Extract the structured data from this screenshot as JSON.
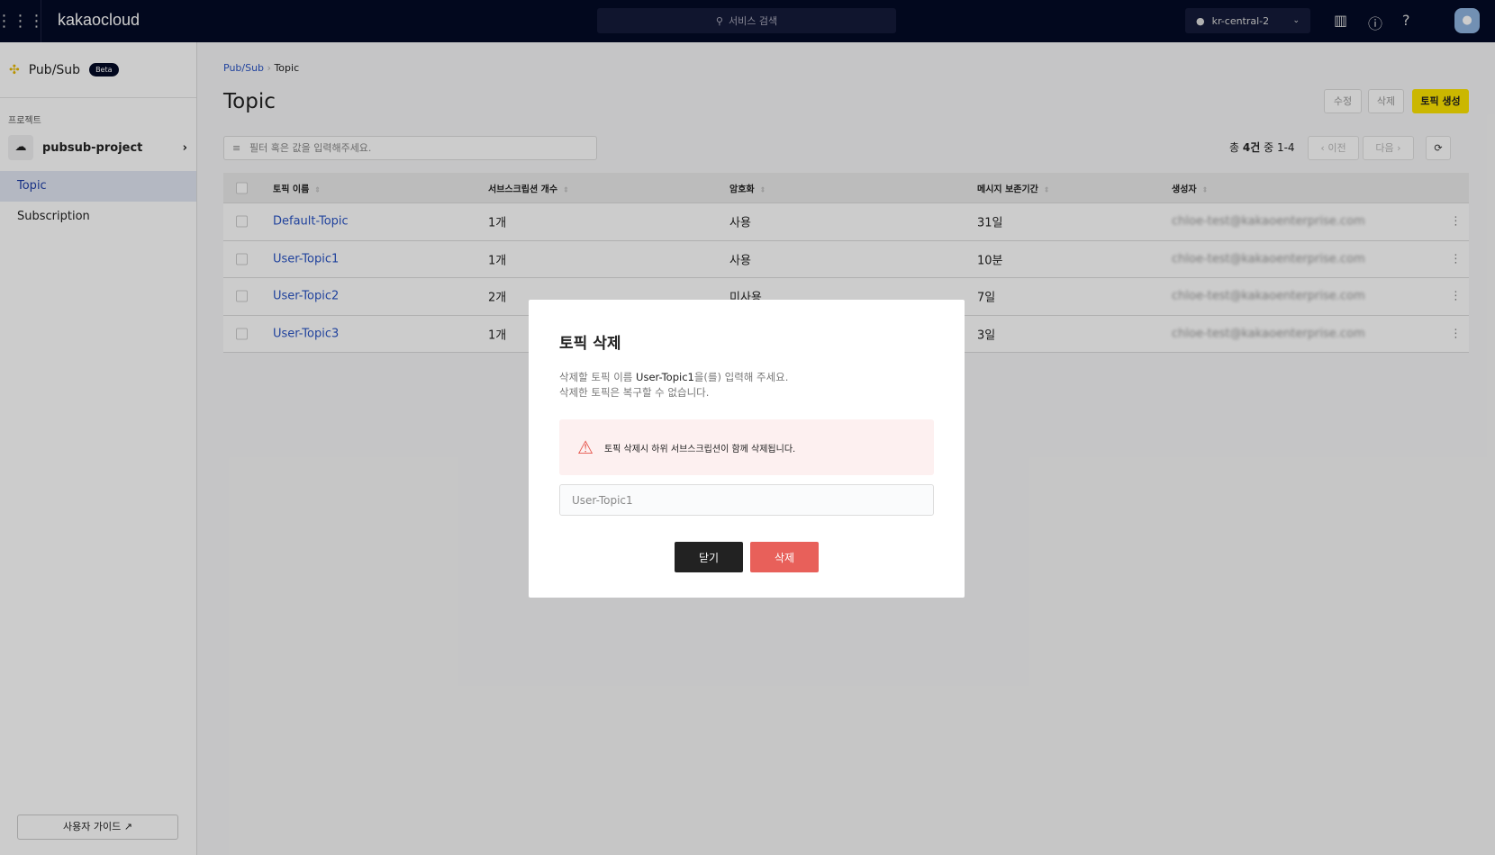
{
  "topbar": {
    "logo": "kakaocloud",
    "search_placeholder": "서비스 검색",
    "region": "kr-central-2"
  },
  "sidebar": {
    "service": "Pub/Sub",
    "badge": "Beta",
    "section": "프로젝트",
    "project": "pubsub-project",
    "items": [
      {
        "label": "Topic",
        "active": true
      },
      {
        "label": "Subscription",
        "active": false
      }
    ],
    "guide": "사용자 가이드"
  },
  "breadcrumb": {
    "parent": "Pub/Sub",
    "current": "Topic"
  },
  "page": {
    "title": "Topic",
    "edit": "수정",
    "delete": "삭제",
    "create": "토픽 생성",
    "filter_placeholder": "필터 혹은 값을 입력해주세요."
  },
  "pagination": {
    "prefix": "총",
    "total": "4건",
    "mid": "중",
    "range": "1-4",
    "prev": "이전",
    "next": "다음"
  },
  "table": {
    "headers": [
      "토픽 이름",
      "서브스크립션 개수",
      "암호화",
      "메시지 보존기간",
      "생성자"
    ],
    "rows": [
      [
        "Default-Topic",
        "1개",
        "사용",
        "31일",
        "chloe-test@kakaoenterprise.com"
      ],
      [
        "User-Topic1",
        "1개",
        "사용",
        "10분",
        "chloe-test@kakaoenterprise.com"
      ],
      [
        "User-Topic2",
        "2개",
        "미사용",
        "7일",
        "chloe-test@kakaoenterprise.com"
      ],
      [
        "User-Topic3",
        "1개",
        "",
        "3일",
        "chloe-test@kakaoenterprise.com"
      ]
    ]
  },
  "modal": {
    "title": "토픽 삭제",
    "desc1_a": "삭제할 토픽 이름 ",
    "desc1_name": "User-Topic1",
    "desc1_b": "을(를) 입력해 주세요.",
    "desc2": "삭제한 토픽은 복구할 수 없습니다.",
    "warning": "토픽 삭제시 하위 서브스크립션이 함께 삭제됩니다.",
    "input_placeholder": "User-Topic1",
    "close": "닫기",
    "confirm": "삭제",
    "colors": {
      "confirm": "#e8605a",
      "close": "#222222",
      "warning_bg": "#fdf0f0"
    }
  }
}
